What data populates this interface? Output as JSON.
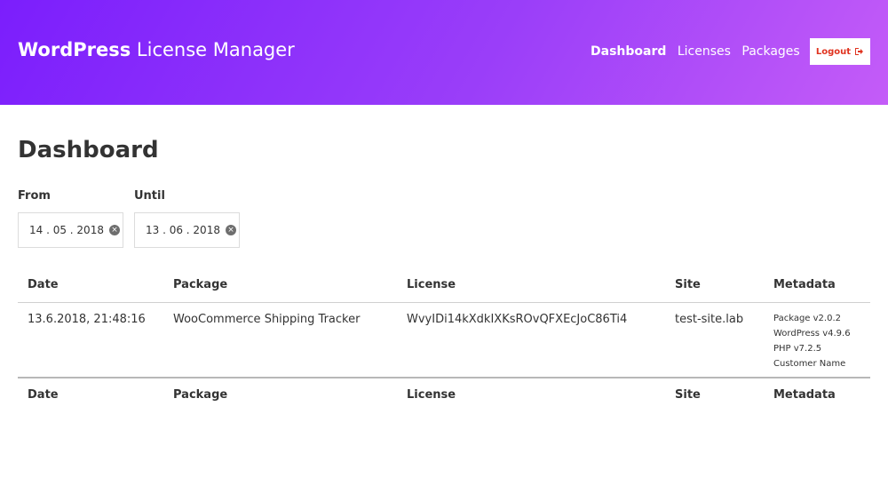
{
  "header": {
    "brand_bold": "WordPress",
    "brand_light": "License Manager",
    "nav": [
      "Dashboard",
      "Licenses",
      "Packages"
    ],
    "logout_label": "Logout"
  },
  "page_title": "Dashboard",
  "filters": {
    "from_label": "From",
    "from_value": "14 . 05 . 2018",
    "until_label": "Until",
    "until_value": "13 . 06 . 2018"
  },
  "table": {
    "columns": [
      "Date",
      "Package",
      "License",
      "Site",
      "Metadata"
    ],
    "rows": [
      {
        "date": "13.6.2018, 21:48:16",
        "package": "WooCommerce Shipping Tracker",
        "license": "WvyIDi14kXdkIXKsROvQFXEcJoC86Ti4",
        "site": "test-site.lab",
        "metadata": [
          "Package v2.0.2",
          "WordPress v4.9.6",
          "PHP v7.2.5",
          "Customer Name"
        ]
      }
    ]
  },
  "colors": {
    "accent": "#8a2bfb",
    "logout_text": "#e0331f"
  },
  "icons": {
    "logout": "sign-out-icon",
    "clear": "clear-circle-icon"
  }
}
